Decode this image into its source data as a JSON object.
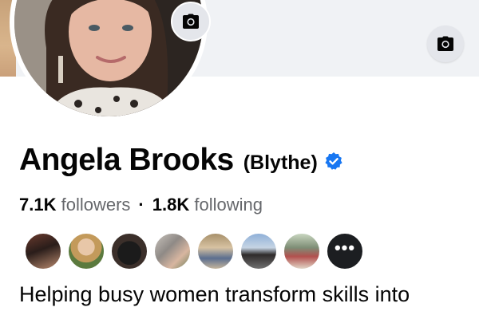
{
  "profile": {
    "name": "Angela Brooks",
    "alternate_name": "(Blythe)",
    "verified_icon": "verified-badge-icon",
    "accent_color": "#1877f2"
  },
  "stats": {
    "followers_count": "7.1K",
    "followers_label": "followers",
    "separator": "·",
    "following_count": "1.8K",
    "following_label": "following"
  },
  "mutual_friends": {
    "more_label": "•••"
  },
  "bio": {
    "text": "Helping busy women transform skills into"
  },
  "icons": {
    "cover_camera": "camera-icon",
    "avatar_camera": "camera-icon"
  }
}
